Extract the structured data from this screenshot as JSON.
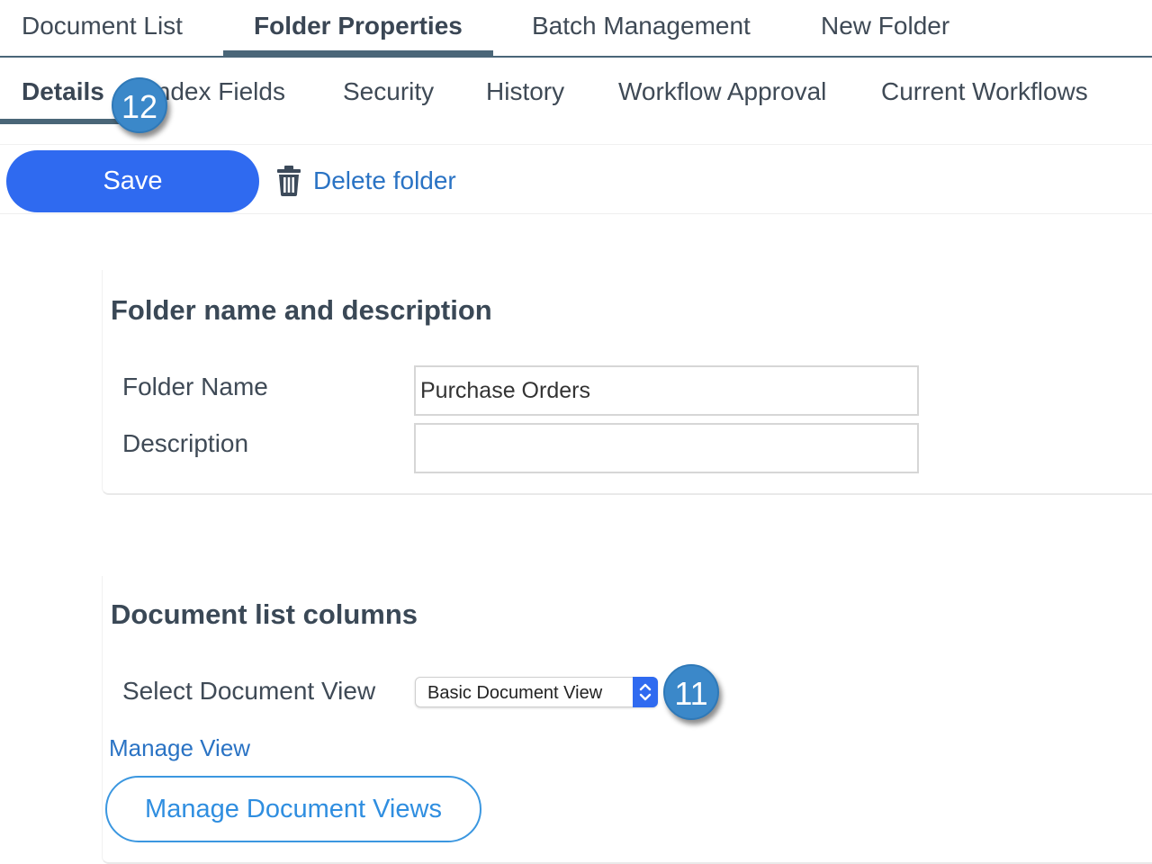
{
  "top_tabs": [
    {
      "label": "Document List"
    },
    {
      "label": "Folder Properties",
      "active": true
    },
    {
      "label": "Batch Management"
    },
    {
      "label": "New Folder"
    }
  ],
  "sub_tabs": [
    {
      "label": "Details",
      "active": true
    },
    {
      "label": "Index Fields"
    },
    {
      "label": "Security"
    },
    {
      "label": "History"
    },
    {
      "label": "Workflow Approval"
    },
    {
      "label": "Current Workflows"
    }
  ],
  "toolbar": {
    "save_label": "Save",
    "delete_label": "Delete folder"
  },
  "folder_section": {
    "title": "Folder name and description",
    "folder_name_label": "Folder Name",
    "folder_name_value": "Purchase Orders",
    "description_label": "Description",
    "description_value": ""
  },
  "columns_section": {
    "title": "Document list columns",
    "select_label": "Select Document View",
    "select_value": "Basic Document View",
    "manage_view_link": "Manage View",
    "manage_views_button": "Manage Document Views"
  },
  "annotations": {
    "badge_details": "12",
    "badge_select": "11"
  },
  "colors": {
    "accent": "#2f6af0",
    "link": "#2a73c4",
    "badge": "#3b88c9",
    "tab_indicator": "#4a6678"
  },
  "icons": {
    "delete": "trash-icon",
    "select": "chevron-up-down-icon"
  }
}
